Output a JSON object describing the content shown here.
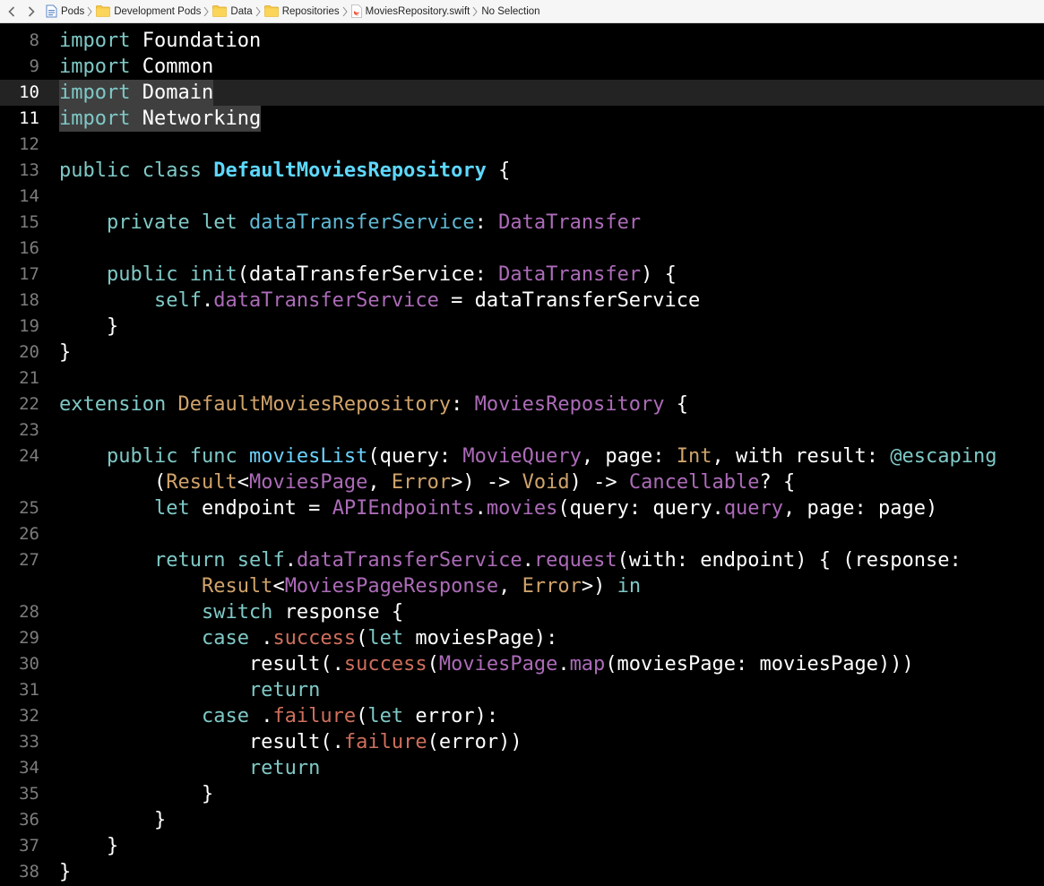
{
  "jumpbar": {
    "crumbs": [
      {
        "label": "Pods",
        "icon": "project-icon"
      },
      {
        "label": "Development Pods",
        "icon": "folder-icon"
      },
      {
        "label": "Data",
        "icon": "folder-icon"
      },
      {
        "label": "Repositories",
        "icon": "folder-icon"
      },
      {
        "label": "MoviesRepository.swift",
        "icon": "swift-file-icon"
      },
      {
        "label": "No Selection",
        "icon": ""
      }
    ]
  },
  "editor": {
    "theme": {
      "background": "#000000",
      "current_line": "#232323"
    },
    "lines": [
      {
        "n": "8"
      },
      {
        "n": "9"
      },
      {
        "n": "10"
      },
      {
        "n": "11"
      },
      {
        "n": "12"
      },
      {
        "n": "13"
      },
      {
        "n": "14"
      },
      {
        "n": "15"
      },
      {
        "n": "16"
      },
      {
        "n": "17"
      },
      {
        "n": "18"
      },
      {
        "n": "19"
      },
      {
        "n": "20"
      },
      {
        "n": "21"
      },
      {
        "n": "22"
      },
      {
        "n": "23"
      },
      {
        "n": "24"
      },
      {
        "n": "25"
      },
      {
        "n": "26"
      },
      {
        "n": "27"
      },
      {
        "n": "28"
      },
      {
        "n": "29"
      },
      {
        "n": "30"
      },
      {
        "n": "31"
      },
      {
        "n": "32"
      },
      {
        "n": "33"
      },
      {
        "n": "34"
      },
      {
        "n": "35"
      },
      {
        "n": "36"
      },
      {
        "n": "37"
      },
      {
        "n": "38"
      }
    ],
    "tokens": {
      "import": "import",
      "foundation": "Foundation",
      "common": "Common",
      "domain": "Domain",
      "networking": "Networking",
      "public": "public",
      "class": "class",
      "default_repo": "DefaultMoviesRepository",
      "open_brace": " {",
      "private": "private",
      "let": "let",
      "dts": "dataTransferService",
      "colon": ":",
      "data_transfer": "DataTransfer",
      "init": "init",
      "self": "self",
      "dot": ".",
      "assign": " = ",
      "close_brace": "}",
      "extension": "extension",
      "movies_repository": "MoviesRepository",
      "func": "func",
      "movies_list": "moviesList",
      "query_label": "(query: ",
      "movie_query": "MovieQuery",
      "page_label": ", page: ",
      "int": "Int",
      "with_result": ", with result: ",
      "escaping": "@escaping",
      "open_paren": "(",
      "result": "Result",
      "lt": "<",
      "movies_page": "MoviesPage",
      "comma_sp": ", ",
      "error": "Error",
      "gt_paren_arrow": ">) -> ",
      "void": "Void",
      "paren_arrow": ") -> ",
      "cancellable": "Cancellable",
      "optional_brace": "? {",
      "endpoint": "endpoint",
      "api_endpoints": "APIEndpoints",
      "movies": "movies",
      "query_query": "(query: query.",
      "query": "query",
      "page_page": ", page: page)",
      "return": "return",
      "request": "request",
      "with_endpoint": "(with: endpoint) { (response:",
      "movies_page_response": "MoviesPageResponse",
      "gt_paren": ">) ",
      "in": "in",
      "switch": "switch",
      "response_brace": " response {",
      "case": "case",
      "success": "success",
      "failure": "failure",
      "movies_page_var": " moviesPage):",
      "result_call": "result(.",
      "map": "map",
      "map_args": "(moviesPage: moviesPage)))",
      "error_var": " error):",
      "error_call": "(error))",
      "open_paren_let": "("
    }
  }
}
